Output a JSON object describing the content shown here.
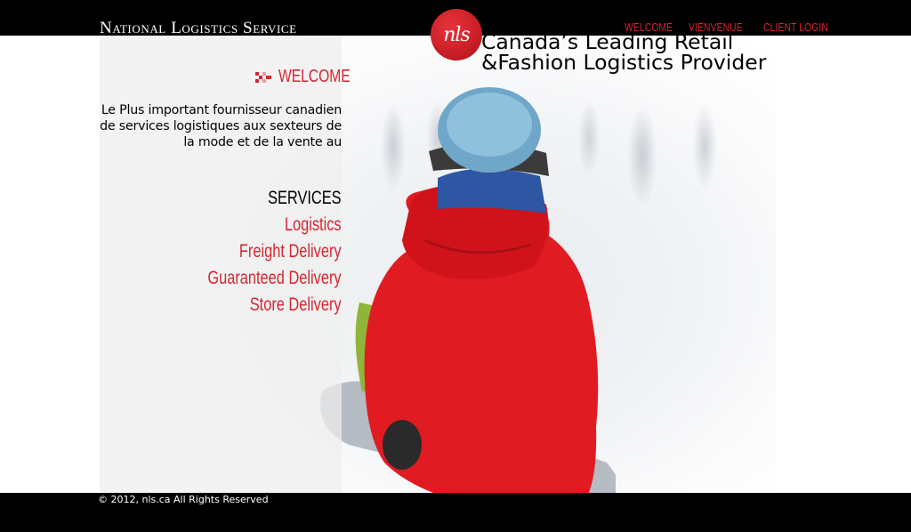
{
  "header": {
    "brand_name": "National Logistics Service",
    "logo_text": "nls",
    "tagline_line1": "Canada’s Leading Retail",
    "tagline_line2": "&Fashion Logistics Provider",
    "nav": [
      {
        "label": "WELCOME"
      },
      {
        "label": "VIENVENUE"
      },
      {
        "label": "CLIENT LOGIN"
      }
    ]
  },
  "sidebar": {
    "welcome_title": "WELCOME",
    "intro_text": "Le Plus important fournisseur canadien de services logistiques aux sexteurs de la mode et de la vente au",
    "services_heading": "SERVICES",
    "services": [
      {
        "label": "Logistics"
      },
      {
        "label": "Freight Delivery"
      },
      {
        "label": "Guaranteed Delivery"
      },
      {
        "label": "Store Delivery"
      }
    ]
  },
  "footer": {
    "copyright": "© 2012, nls.ca All Rights Reserved"
  },
  "colors": {
    "accent": "#d42630",
    "background": "#000000",
    "panel": "#eeeeee"
  },
  "icons": {
    "welcome_marker": "checker-arrow-icon",
    "logo": "nls-logo"
  }
}
